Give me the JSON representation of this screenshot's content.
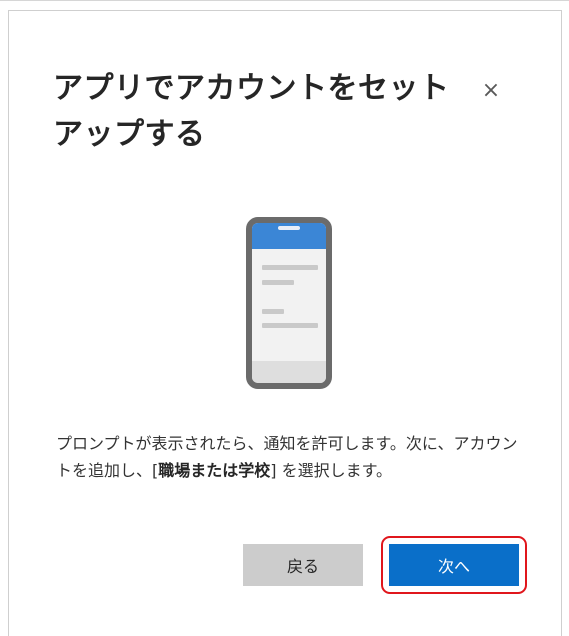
{
  "dialog": {
    "title": "アプリでアカウントをセットアップする",
    "close_label": "×",
    "description": {
      "before": "プロンプトが表示されたら、通知を許可します。次に、アカウントを追加し、[",
      "bold": "職場または学校",
      "after": "] を選択します。"
    },
    "buttons": {
      "back": "戻る",
      "next": "次へ"
    },
    "illustration": "phone-icon"
  },
  "colors": {
    "primary_button": "#0a6fc9",
    "secondary_button": "#cccccc",
    "highlight_border": "#e0161c",
    "phone_header": "#3b86d6"
  }
}
